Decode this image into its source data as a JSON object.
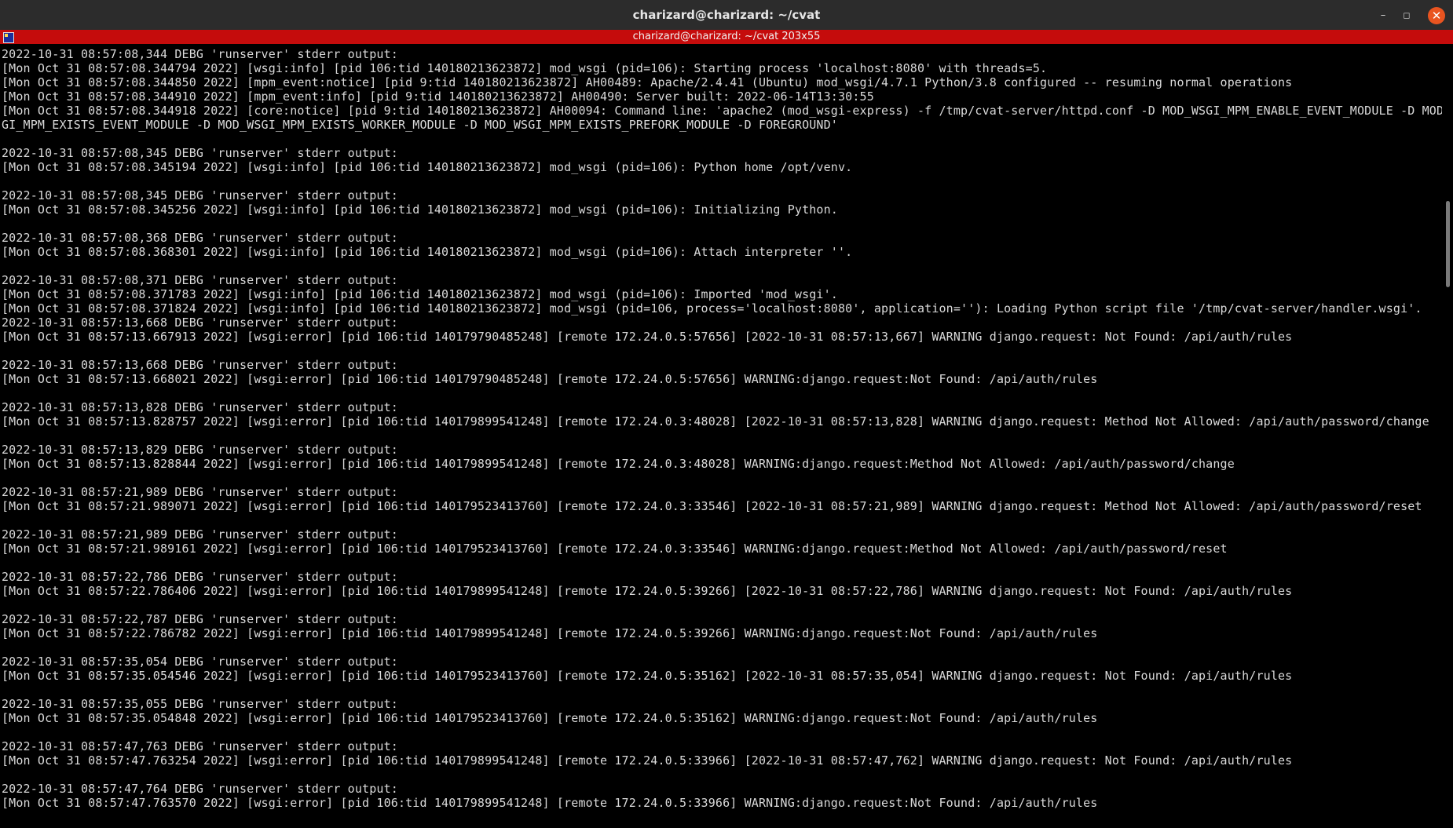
{
  "window": {
    "title": "charizard@charizard: ~/cvat",
    "controls": {
      "minimize": "–",
      "maximize": "◻",
      "close": "✕"
    }
  },
  "tmux": {
    "status": "charizard@charizard: ~/cvat 203x55",
    "icon": "tmux-pane-icon"
  },
  "terminal": {
    "lines": [
      "2022-10-31 08:57:08,344 DEBG 'runserver' stderr output:",
      "[Mon Oct 31 08:57:08.344794 2022] [wsgi:info] [pid 106:tid 140180213623872] mod_wsgi (pid=106): Starting process 'localhost:8080' with threads=5.",
      "[Mon Oct 31 08:57:08.344850 2022] [mpm_event:notice] [pid 9:tid 140180213623872] AH00489: Apache/2.4.41 (Ubuntu) mod_wsgi/4.7.1 Python/3.8 configured -- resuming normal operations",
      "[Mon Oct 31 08:57:08.344910 2022] [mpm_event:info] [pid 9:tid 140180213623872] AH00490: Server built: 2022-06-14T13:30:55",
      "[Mon Oct 31 08:57:08.344918 2022] [core:notice] [pid 9:tid 140180213623872] AH00094: Command line: 'apache2 (mod_wsgi-express) -f /tmp/cvat-server/httpd.conf -D MOD_WSGI_MPM_ENABLE_EVENT_MODULE -D MOD_WS",
      "GI_MPM_EXISTS_EVENT_MODULE -D MOD_WSGI_MPM_EXISTS_WORKER_MODULE -D MOD_WSGI_MPM_EXISTS_PREFORK_MODULE -D FOREGROUND'",
      "",
      "2022-10-31 08:57:08,345 DEBG 'runserver' stderr output:",
      "[Mon Oct 31 08:57:08.345194 2022] [wsgi:info] [pid 106:tid 140180213623872] mod_wsgi (pid=106): Python home /opt/venv.",
      "",
      "2022-10-31 08:57:08,345 DEBG 'runserver' stderr output:",
      "[Mon Oct 31 08:57:08.345256 2022] [wsgi:info] [pid 106:tid 140180213623872] mod_wsgi (pid=106): Initializing Python.",
      "",
      "2022-10-31 08:57:08,368 DEBG 'runserver' stderr output:",
      "[Mon Oct 31 08:57:08.368301 2022] [wsgi:info] [pid 106:tid 140180213623872] mod_wsgi (pid=106): Attach interpreter ''.",
      "",
      "2022-10-31 08:57:08,371 DEBG 'runserver' stderr output:",
      "[Mon Oct 31 08:57:08.371783 2022] [wsgi:info] [pid 106:tid 140180213623872] mod_wsgi (pid=106): Imported 'mod_wsgi'.",
      "[Mon Oct 31 08:57:08.371824 2022] [wsgi:info] [pid 106:tid 140180213623872] mod_wsgi (pid=106, process='localhost:8080', application=''): Loading Python script file '/tmp/cvat-server/handler.wsgi'.",
      "2022-10-31 08:57:13,668 DEBG 'runserver' stderr output:",
      "[Mon Oct 31 08:57:13.667913 2022] [wsgi:error] [pid 106:tid 140179790485248] [remote 172.24.0.5:57656] [2022-10-31 08:57:13,667] WARNING django.request: Not Found: /api/auth/rules",
      "",
      "2022-10-31 08:57:13,668 DEBG 'runserver' stderr output:",
      "[Mon Oct 31 08:57:13.668021 2022] [wsgi:error] [pid 106:tid 140179790485248] [remote 172.24.0.5:57656] WARNING:django.request:Not Found: /api/auth/rules",
      "",
      "2022-10-31 08:57:13,828 DEBG 'runserver' stderr output:",
      "[Mon Oct 31 08:57:13.828757 2022] [wsgi:error] [pid 106:tid 140179899541248] [remote 172.24.0.3:48028] [2022-10-31 08:57:13,828] WARNING django.request: Method Not Allowed: /api/auth/password/change",
      "",
      "2022-10-31 08:57:13,829 DEBG 'runserver' stderr output:",
      "[Mon Oct 31 08:57:13.828844 2022] [wsgi:error] [pid 106:tid 140179899541248] [remote 172.24.0.3:48028] WARNING:django.request:Method Not Allowed: /api/auth/password/change",
      "",
      "2022-10-31 08:57:21,989 DEBG 'runserver' stderr output:",
      "[Mon Oct 31 08:57:21.989071 2022] [wsgi:error] [pid 106:tid 140179523413760] [remote 172.24.0.3:33546] [2022-10-31 08:57:21,989] WARNING django.request: Method Not Allowed: /api/auth/password/reset",
      "",
      "2022-10-31 08:57:21,989 DEBG 'runserver' stderr output:",
      "[Mon Oct 31 08:57:21.989161 2022] [wsgi:error] [pid 106:tid 140179523413760] [remote 172.24.0.3:33546] WARNING:django.request:Method Not Allowed: /api/auth/password/reset",
      "",
      "2022-10-31 08:57:22,786 DEBG 'runserver' stderr output:",
      "[Mon Oct 31 08:57:22.786406 2022] [wsgi:error] [pid 106:tid 140179899541248] [remote 172.24.0.5:39266] [2022-10-31 08:57:22,786] WARNING django.request: Not Found: /api/auth/rules",
      "",
      "2022-10-31 08:57:22,787 DEBG 'runserver' stderr output:",
      "[Mon Oct 31 08:57:22.786782 2022] [wsgi:error] [pid 106:tid 140179899541248] [remote 172.24.0.5:39266] WARNING:django.request:Not Found: /api/auth/rules",
      "",
      "2022-10-31 08:57:35,054 DEBG 'runserver' stderr output:",
      "[Mon Oct 31 08:57:35.054546 2022] [wsgi:error] [pid 106:tid 140179523413760] [remote 172.24.0.5:35162] [2022-10-31 08:57:35,054] WARNING django.request: Not Found: /api/auth/rules",
      "",
      "2022-10-31 08:57:35,055 DEBG 'runserver' stderr output:",
      "[Mon Oct 31 08:57:35.054848 2022] [wsgi:error] [pid 106:tid 140179523413760] [remote 172.24.0.5:35162] WARNING:django.request:Not Found: /api/auth/rules",
      "",
      "2022-10-31 08:57:47,763 DEBG 'runserver' stderr output:",
      "[Mon Oct 31 08:57:47.763254 2022] [wsgi:error] [pid 106:tid 140179899541248] [remote 172.24.0.5:33966] [2022-10-31 08:57:47,762] WARNING django.request: Not Found: /api/auth/rules",
      "",
      "2022-10-31 08:57:47,764 DEBG 'runserver' stderr output:",
      "[Mon Oct 31 08:57:47.763570 2022] [wsgi:error] [pid 106:tid 140179899541248] [remote 172.24.0.5:33966] WARNING:django.request:Not Found: /api/auth/rules"
    ]
  }
}
